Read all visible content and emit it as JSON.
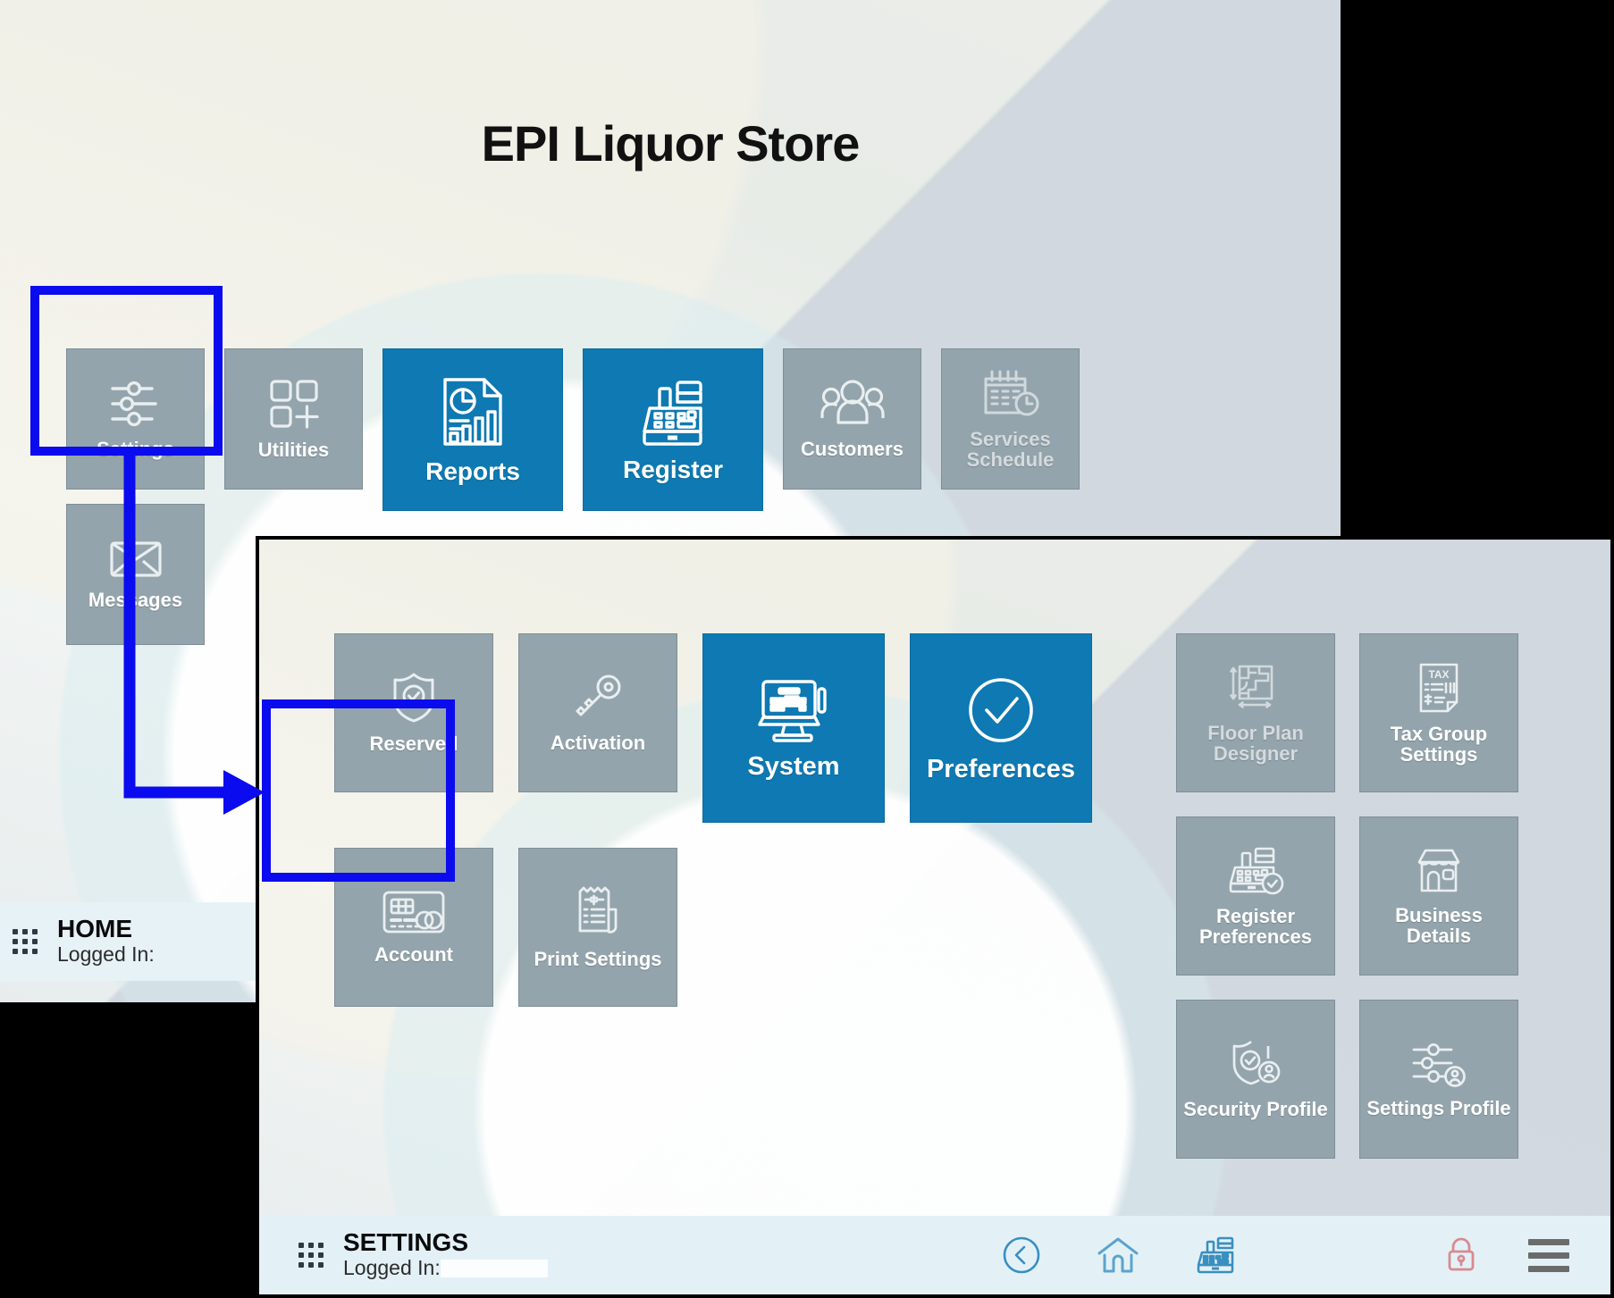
{
  "home_window": {
    "title": "EPI Liquor Store",
    "tiles": [
      {
        "label": "Settings",
        "icon": "sliders-icon",
        "style": "gray",
        "size": "md",
        "highlighted": true
      },
      {
        "label": "Messages",
        "icon": "envelope-icon",
        "style": "gray",
        "size": "md",
        "highlighted": false
      },
      {
        "label": "Utilities",
        "icon": "grid-plus-icon",
        "style": "gray",
        "size": "md",
        "highlighted": false
      },
      {
        "label": "Reports",
        "icon": "report-chart-icon",
        "style": "blue",
        "size": "lg",
        "highlighted": false
      },
      {
        "label": "Register",
        "icon": "cash-register-icon",
        "style": "blue",
        "size": "lg",
        "highlighted": false
      },
      {
        "label": "Customers",
        "icon": "users-icon",
        "style": "gray",
        "size": "md",
        "highlighted": false
      },
      {
        "label": "Services Schedule",
        "icon": "calendar-clock-icon",
        "style": "gray-dim",
        "size": "md",
        "highlighted": false
      }
    ],
    "status_bar": {
      "title": "HOME",
      "logged_in_label": "Logged In:",
      "logged_in_value": ""
    }
  },
  "settings_window": {
    "left_tiles": [
      {
        "label": "Reserved",
        "icon": "shield-check-icon",
        "style": "gray",
        "size": "sm",
        "highlighted": false
      },
      {
        "label": "Activation",
        "icon": "key-icon",
        "style": "gray",
        "size": "sm",
        "highlighted": false
      },
      {
        "label": "System",
        "icon": "pos-monitor-icon",
        "style": "blue",
        "size": "lg",
        "highlighted": false
      },
      {
        "label": "Preferences",
        "icon": "check-circle-icon",
        "style": "blue",
        "size": "lg",
        "highlighted": false
      },
      {
        "label": "Account",
        "icon": "credit-card-icon",
        "style": "gray",
        "size": "sm",
        "highlighted": true
      },
      {
        "label": "Print Settings",
        "icon": "receipt-icon",
        "style": "gray",
        "size": "sm",
        "highlighted": false
      }
    ],
    "right_tiles": [
      {
        "label": "Floor Plan Designer",
        "icon": "floor-plan-icon",
        "style": "gray-dim"
      },
      {
        "label": "Tax Group Settings",
        "icon": "tax-document-icon",
        "style": "gray"
      },
      {
        "label": "Register Preferences",
        "icon": "register-check-icon",
        "style": "gray"
      },
      {
        "label": "Business Details",
        "icon": "storefront-icon",
        "style": "gray"
      },
      {
        "label": "Security Profile",
        "icon": "shield-user-icon",
        "style": "gray"
      },
      {
        "label": "Settings Profile",
        "icon": "sliders-user-icon",
        "style": "gray"
      }
    ],
    "status_bar": {
      "title": "SETTINGS",
      "logged_in_label": "Logged In:",
      "logged_in_value": "",
      "center_icons": [
        "back-circle-icon",
        "home-icon",
        "cash-register-icon"
      ],
      "right_icons": [
        "lock-icon",
        "hamburger-menu-icon"
      ]
    }
  },
  "annotations": {
    "highlight_color": "#0b0bef",
    "highlights": [
      "settings-tile",
      "account-tile"
    ],
    "connector": "arrow-from-settings-to-account"
  },
  "colors": {
    "tile_gray": "#94a4ac",
    "tile_blue": "#0e79b2",
    "highlight": "#0b0bef",
    "status_bar_bg": "#e3f1f7",
    "lock_red": "#d98a8f"
  }
}
